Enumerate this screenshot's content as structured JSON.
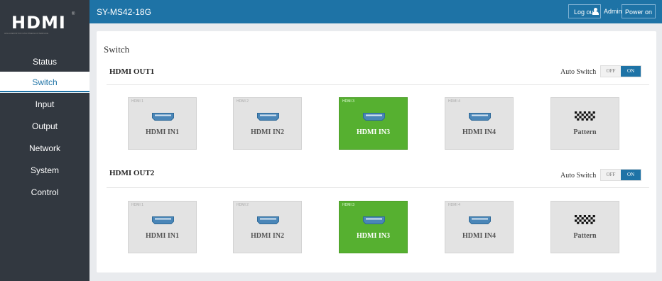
{
  "brand": {
    "logo": "HDMI",
    "tagline": "HIGH-DEFINITION MULTIMEDIA INTERFACE",
    "mark": "®"
  },
  "header": {
    "model": "SY-MS42-18G",
    "user": "Admin",
    "logout_label": "Log out",
    "power_label": "Power on"
  },
  "sidebar": {
    "items": [
      {
        "label": "Status",
        "active": false
      },
      {
        "label": "Switch",
        "active": true
      },
      {
        "label": "Input",
        "active": false
      },
      {
        "label": "Output",
        "active": false
      },
      {
        "label": "Network",
        "active": false
      },
      {
        "label": "System",
        "active": false
      },
      {
        "label": "Control",
        "active": false
      }
    ]
  },
  "main": {
    "title": "Switch",
    "outputs": [
      {
        "name": "HDMI OUT1",
        "auto_switch_label": "Auto Switch",
        "toggle": {
          "off": "OFF",
          "on": "ON",
          "state": "on"
        },
        "inputs": [
          {
            "tag": "HDMI 1",
            "label": "HDMI IN1",
            "icon": "hdmi-port-icon",
            "selected": false
          },
          {
            "tag": "HDMI 2",
            "label": "HDMI IN2",
            "icon": "hdmi-port-icon",
            "selected": false
          },
          {
            "tag": "HDMI 3",
            "label": "HDMI IN3",
            "icon": "hdmi-port-icon",
            "selected": true
          },
          {
            "tag": "HDMI 4",
            "label": "HDMI IN4",
            "icon": "hdmi-port-icon",
            "selected": false
          },
          {
            "tag": "",
            "label": "Pattern",
            "icon": "checker-pattern-icon",
            "selected": false
          }
        ]
      },
      {
        "name": "HDMI OUT2",
        "auto_switch_label": "Auto Switch",
        "toggle": {
          "off": "OFF",
          "on": "ON",
          "state": "on"
        },
        "inputs": [
          {
            "tag": "HDMI 1",
            "label": "HDMI IN1",
            "icon": "hdmi-port-icon",
            "selected": false
          },
          {
            "tag": "HDMI 2",
            "label": "HDMI IN2",
            "icon": "hdmi-port-icon",
            "selected": false
          },
          {
            "tag": "HDMI 3",
            "label": "HDMI IN3",
            "icon": "hdmi-port-icon",
            "selected": true
          },
          {
            "tag": "HDMI 4",
            "label": "HDMI IN4",
            "icon": "hdmi-port-icon",
            "selected": false
          },
          {
            "tag": "",
            "label": "Pattern",
            "icon": "checker-pattern-icon",
            "selected": false
          }
        ]
      }
    ]
  },
  "colors": {
    "sidebar": "#323840",
    "accent": "#1e73a6",
    "selected": "#56b030",
    "tile": "#e3e3e3"
  }
}
